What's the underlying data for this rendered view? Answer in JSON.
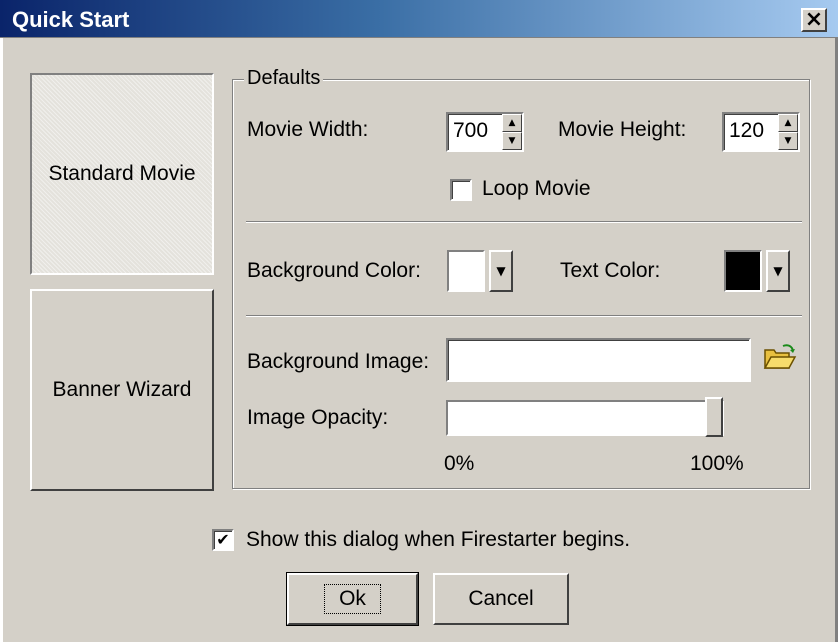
{
  "window": {
    "title": "Quick Start",
    "close_label": "×"
  },
  "modes": {
    "standard": "Standard Movie",
    "banner": "Banner Wizard"
  },
  "defaults": {
    "legend": "Defaults",
    "movie_width_label": "Movie Width:",
    "movie_width_value": "700",
    "movie_height_label": "Movie Height:",
    "movie_height_value": "120",
    "loop_label": "Loop Movie",
    "loop_checked": false,
    "background_color_label": "Background Color:",
    "background_color_value": "#ffffff",
    "text_color_label": "Text Color:",
    "text_color_value": "#000000",
    "background_image_label": "Background Image:",
    "background_image_value": "",
    "opacity_label": "Image Opacity:",
    "opacity_value": 1.0,
    "opacity_min_label": "0%",
    "opacity_max_label": "100%"
  },
  "footer": {
    "show_dialog_label": "Show this dialog when Firestarter begins.",
    "show_dialog_checked": true,
    "check_mark": "✔",
    "ok_label": "Ok",
    "cancel_label": "Cancel"
  },
  "icons": {
    "folder": "open-folder-icon",
    "spin_up": "▲",
    "spin_down": "▼",
    "dropdown": "▼"
  }
}
